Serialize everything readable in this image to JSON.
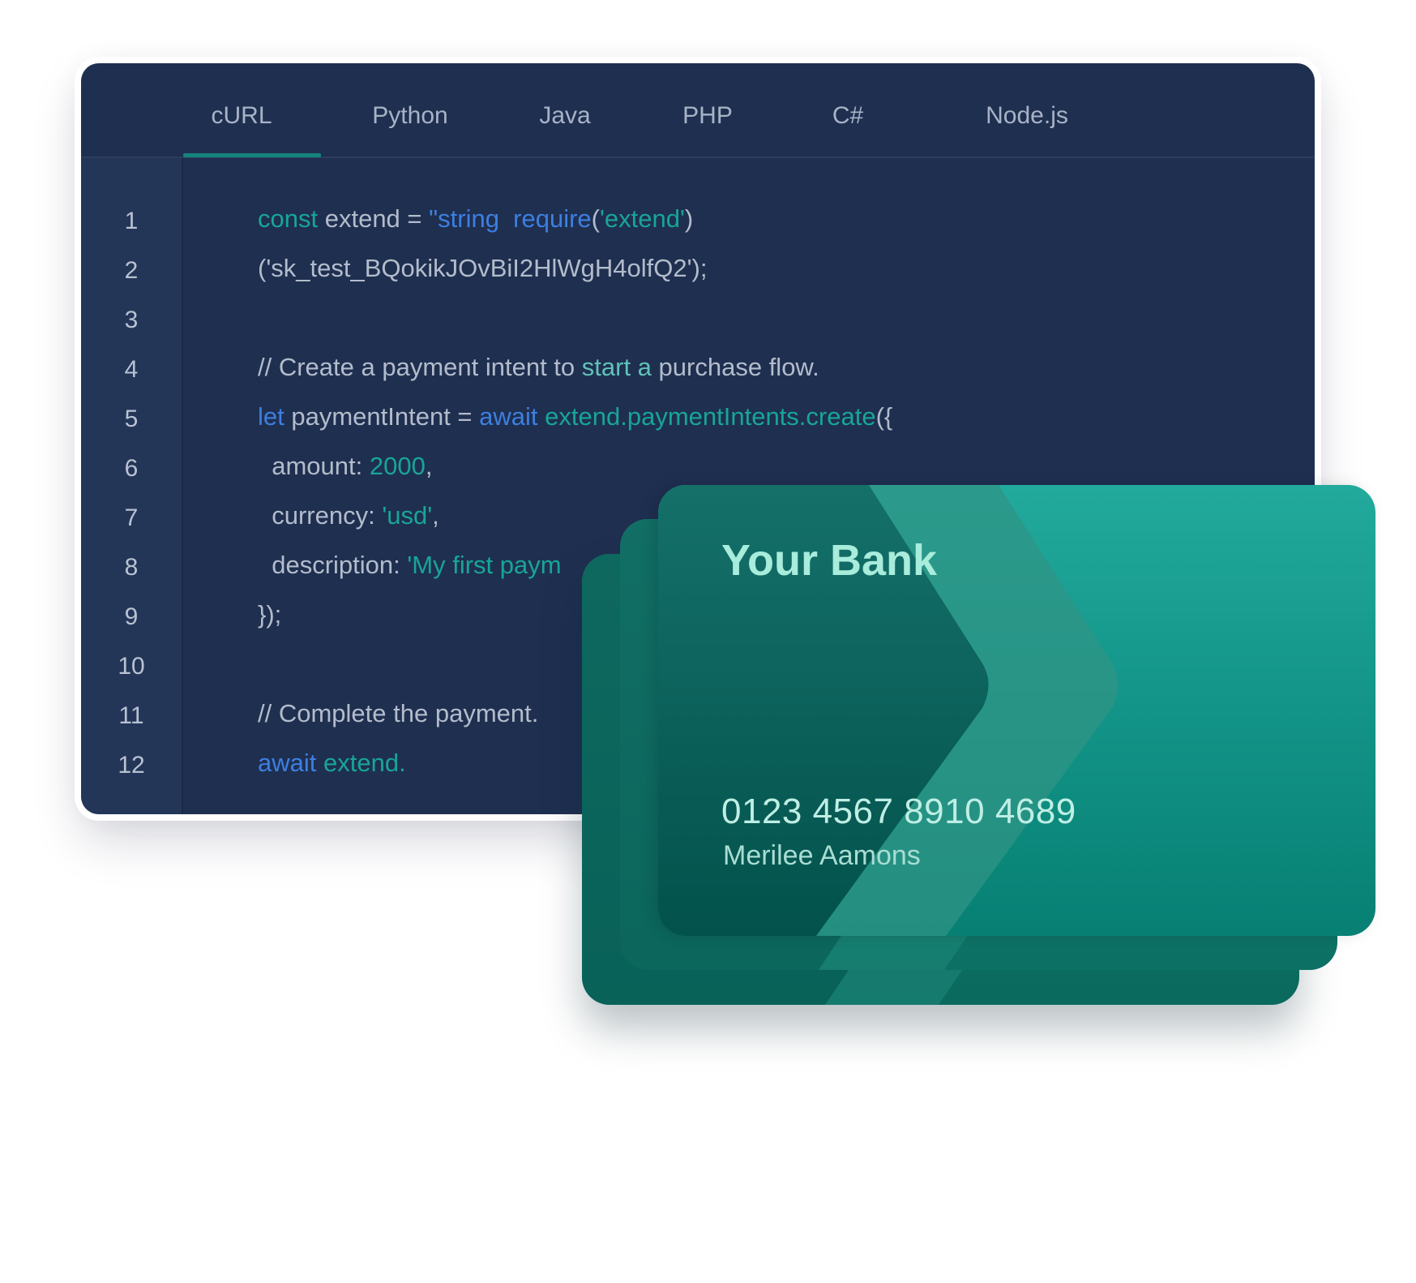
{
  "tabs": [
    {
      "label": "cURL",
      "active": true
    },
    {
      "label": "Python",
      "active": false
    },
    {
      "label": "Java",
      "active": false
    },
    {
      "label": "PHP",
      "active": false
    },
    {
      "label": "C#",
      "active": false
    },
    {
      "label": "Node.js",
      "active": false
    }
  ],
  "colors": {
    "editor_bg": "#1f2f50",
    "gutter_bg": "#233658",
    "accent_teal": "#18a596",
    "accent_blue": "#3d7fe0",
    "card_teal": "#22aa9c"
  },
  "code": {
    "line_numbers": [
      "1",
      "2",
      "3",
      "4",
      "5",
      "6",
      "7",
      "8",
      "9",
      "10",
      "11",
      "12"
    ],
    "lines": [
      [
        {
          "t": "const",
          "c": "teal"
        },
        {
          "t": " extend = ",
          "c": "plain"
        },
        {
          "t": "\"string  require",
          "c": "blue"
        },
        {
          "t": "(",
          "c": "plain"
        },
        {
          "t": "'extend'",
          "c": "teal"
        },
        {
          "t": ")",
          "c": "plain"
        }
      ],
      [
        {
          "t": "('sk_test_BQokikJOvBiI2HlWgH4olfQ2');",
          "c": "plain"
        }
      ],
      [],
      [
        {
          "t": "// Create a payment intent to ",
          "c": "plain"
        },
        {
          "t": "start a",
          "c": "mint"
        },
        {
          "t": " purchase flow.",
          "c": "plain"
        }
      ],
      [
        {
          "t": "let",
          "c": "blue"
        },
        {
          "t": " paymentIntent = ",
          "c": "plain"
        },
        {
          "t": "await",
          "c": "blue"
        },
        {
          "t": " extend.paymentIntents.create",
          "c": "teal"
        },
        {
          "t": "({",
          "c": "plain"
        }
      ],
      [
        {
          "t": "  amount: ",
          "c": "plain"
        },
        {
          "t": "2000",
          "c": "teal"
        },
        {
          "t": ",",
          "c": "plain"
        }
      ],
      [
        {
          "t": "  currency: ",
          "c": "plain"
        },
        {
          "t": "'usd'",
          "c": "teal"
        },
        {
          "t": ",",
          "c": "plain"
        }
      ],
      [
        {
          "t": "  description: ",
          "c": "plain"
        },
        {
          "t": "'My first paym",
          "c": "teal"
        }
      ],
      [
        {
          "t": "});",
          "c": "plain"
        }
      ],
      [],
      [
        {
          "t": "// Complete the payment.",
          "c": "plain"
        }
      ],
      [
        {
          "t": "await",
          "c": "blue"
        },
        {
          "t": " extend.",
          "c": "teal"
        }
      ]
    ]
  },
  "card": {
    "bank_name": "Your Bank",
    "number": "0123 4567 8910 4689",
    "holder": "Merilee Aamons"
  }
}
